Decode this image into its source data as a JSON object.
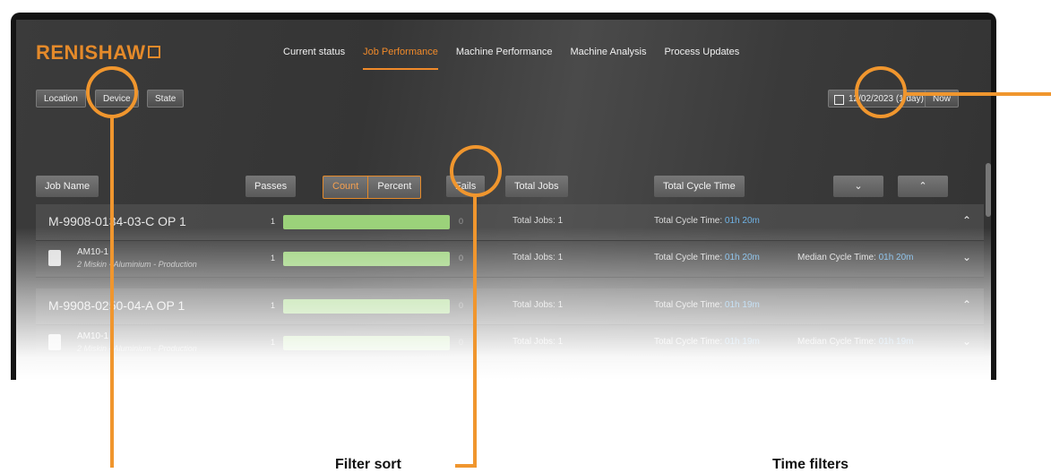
{
  "app": {
    "logo": "RENISHAW"
  },
  "nav": {
    "items": [
      "Current status",
      "Job Performance",
      "Machine Performance",
      "Machine Analysis",
      "Process Updates"
    ],
    "active_index": 1
  },
  "filters": {
    "location": "Location",
    "device": "Device",
    "state": "State",
    "date": "12/02/2023 (1 day)",
    "now": "Now"
  },
  "columns": {
    "job_name": "Job Name",
    "passes": "Passes",
    "count": "Count",
    "percent": "Percent",
    "fails": "Fails",
    "total_jobs": "Total Jobs",
    "total_cycle_time": "Total Cycle Time",
    "expand_all": "⌄",
    "collapse_all": "⌃"
  },
  "rows": [
    {
      "type": "job",
      "name": "M-9908-0134-03-C OP 1",
      "passes": "1",
      "fails": "0",
      "total_jobs": "Total Jobs: 1",
      "tct_label": "Total Cycle Time:",
      "tct_value": "01h 20m",
      "chevron": "⌃"
    },
    {
      "type": "device",
      "name": "AM10-1",
      "sub": "2 Miskin - Aluminium - Production",
      "passes": "1",
      "fails": "0",
      "total_jobs": "Total Jobs: 1",
      "tct_label": "Total Cycle Time:",
      "tct_value": "01h 20m",
      "mct_label": "Median Cycle Time:",
      "mct_value": "01h 20m",
      "chevron": "⌄"
    },
    {
      "type": "job",
      "name": "M-9908-0250-04-A OP 1",
      "passes": "1",
      "fails": "0",
      "total_jobs": "Total Jobs: 1",
      "tct_label": "Total Cycle Time:",
      "tct_value": "01h 19m",
      "chevron": "⌃"
    },
    {
      "type": "device",
      "name": "AM10-1",
      "sub": "2 Miskin - Aluminium - Production",
      "passes": "1",
      "fails": "0",
      "total_jobs": "Total Jobs: 1",
      "tct_label": "Total Cycle Time:",
      "tct_value": "01h 19m",
      "mct_label": "Median Cycle Time:",
      "mct_value": "01h 19m",
      "chevron": "⌄"
    }
  ],
  "annotations": {
    "filter_sort": "Filter sort",
    "time_filters": "Time filters"
  },
  "colors": {
    "accent": "#f0962e",
    "bar": "#9bd27a",
    "value_blue": "#6fb3e6"
  }
}
